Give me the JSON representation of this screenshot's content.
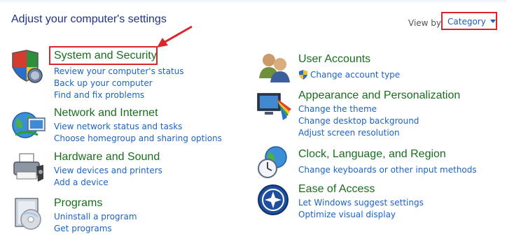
{
  "header": {
    "title": "Adjust your computer's settings",
    "view_by_label": "View by:",
    "view_by_value": "Category"
  },
  "categories": {
    "system_security": {
      "title": "System and Security",
      "links": [
        "Review your computer's status",
        "Back up your computer",
        "Find and fix problems"
      ]
    },
    "network_internet": {
      "title": "Network and Internet",
      "links": [
        "View network status and tasks",
        "Choose homegroup and sharing options"
      ]
    },
    "hardware_sound": {
      "title": "Hardware and Sound",
      "links": [
        "View devices and printers",
        "Add a device"
      ]
    },
    "programs": {
      "title": "Programs",
      "links": [
        "Uninstall a program",
        "Get programs"
      ]
    },
    "user_accounts": {
      "title": "User Accounts",
      "links": [
        "Change account type"
      ]
    },
    "appearance": {
      "title": "Appearance and Personalization",
      "links": [
        "Change the theme",
        "Change desktop background",
        "Adjust screen resolution"
      ]
    },
    "clock_region": {
      "title": "Clock, Language, and Region",
      "links": [
        "Change keyboards or other input methods"
      ]
    },
    "ease_access": {
      "title": "Ease of Access",
      "links": [
        "Let Windows suggest settings",
        "Optimize visual display"
      ]
    }
  },
  "icons": {
    "system_security": "shield-icon",
    "network_internet": "network-globe-icon",
    "hardware_sound": "printer-icon",
    "programs": "programs-disc-icon",
    "user_accounts": "users-icon",
    "appearance": "monitor-palette-icon",
    "clock_region": "clock-globe-icon",
    "ease_access": "ease-of-access-icon",
    "uac_shield": "uac-shield-icon"
  },
  "annotation_colors": {
    "highlight": "#d9262b",
    "link": "#1c63c4",
    "category_title": "#196e1d"
  }
}
